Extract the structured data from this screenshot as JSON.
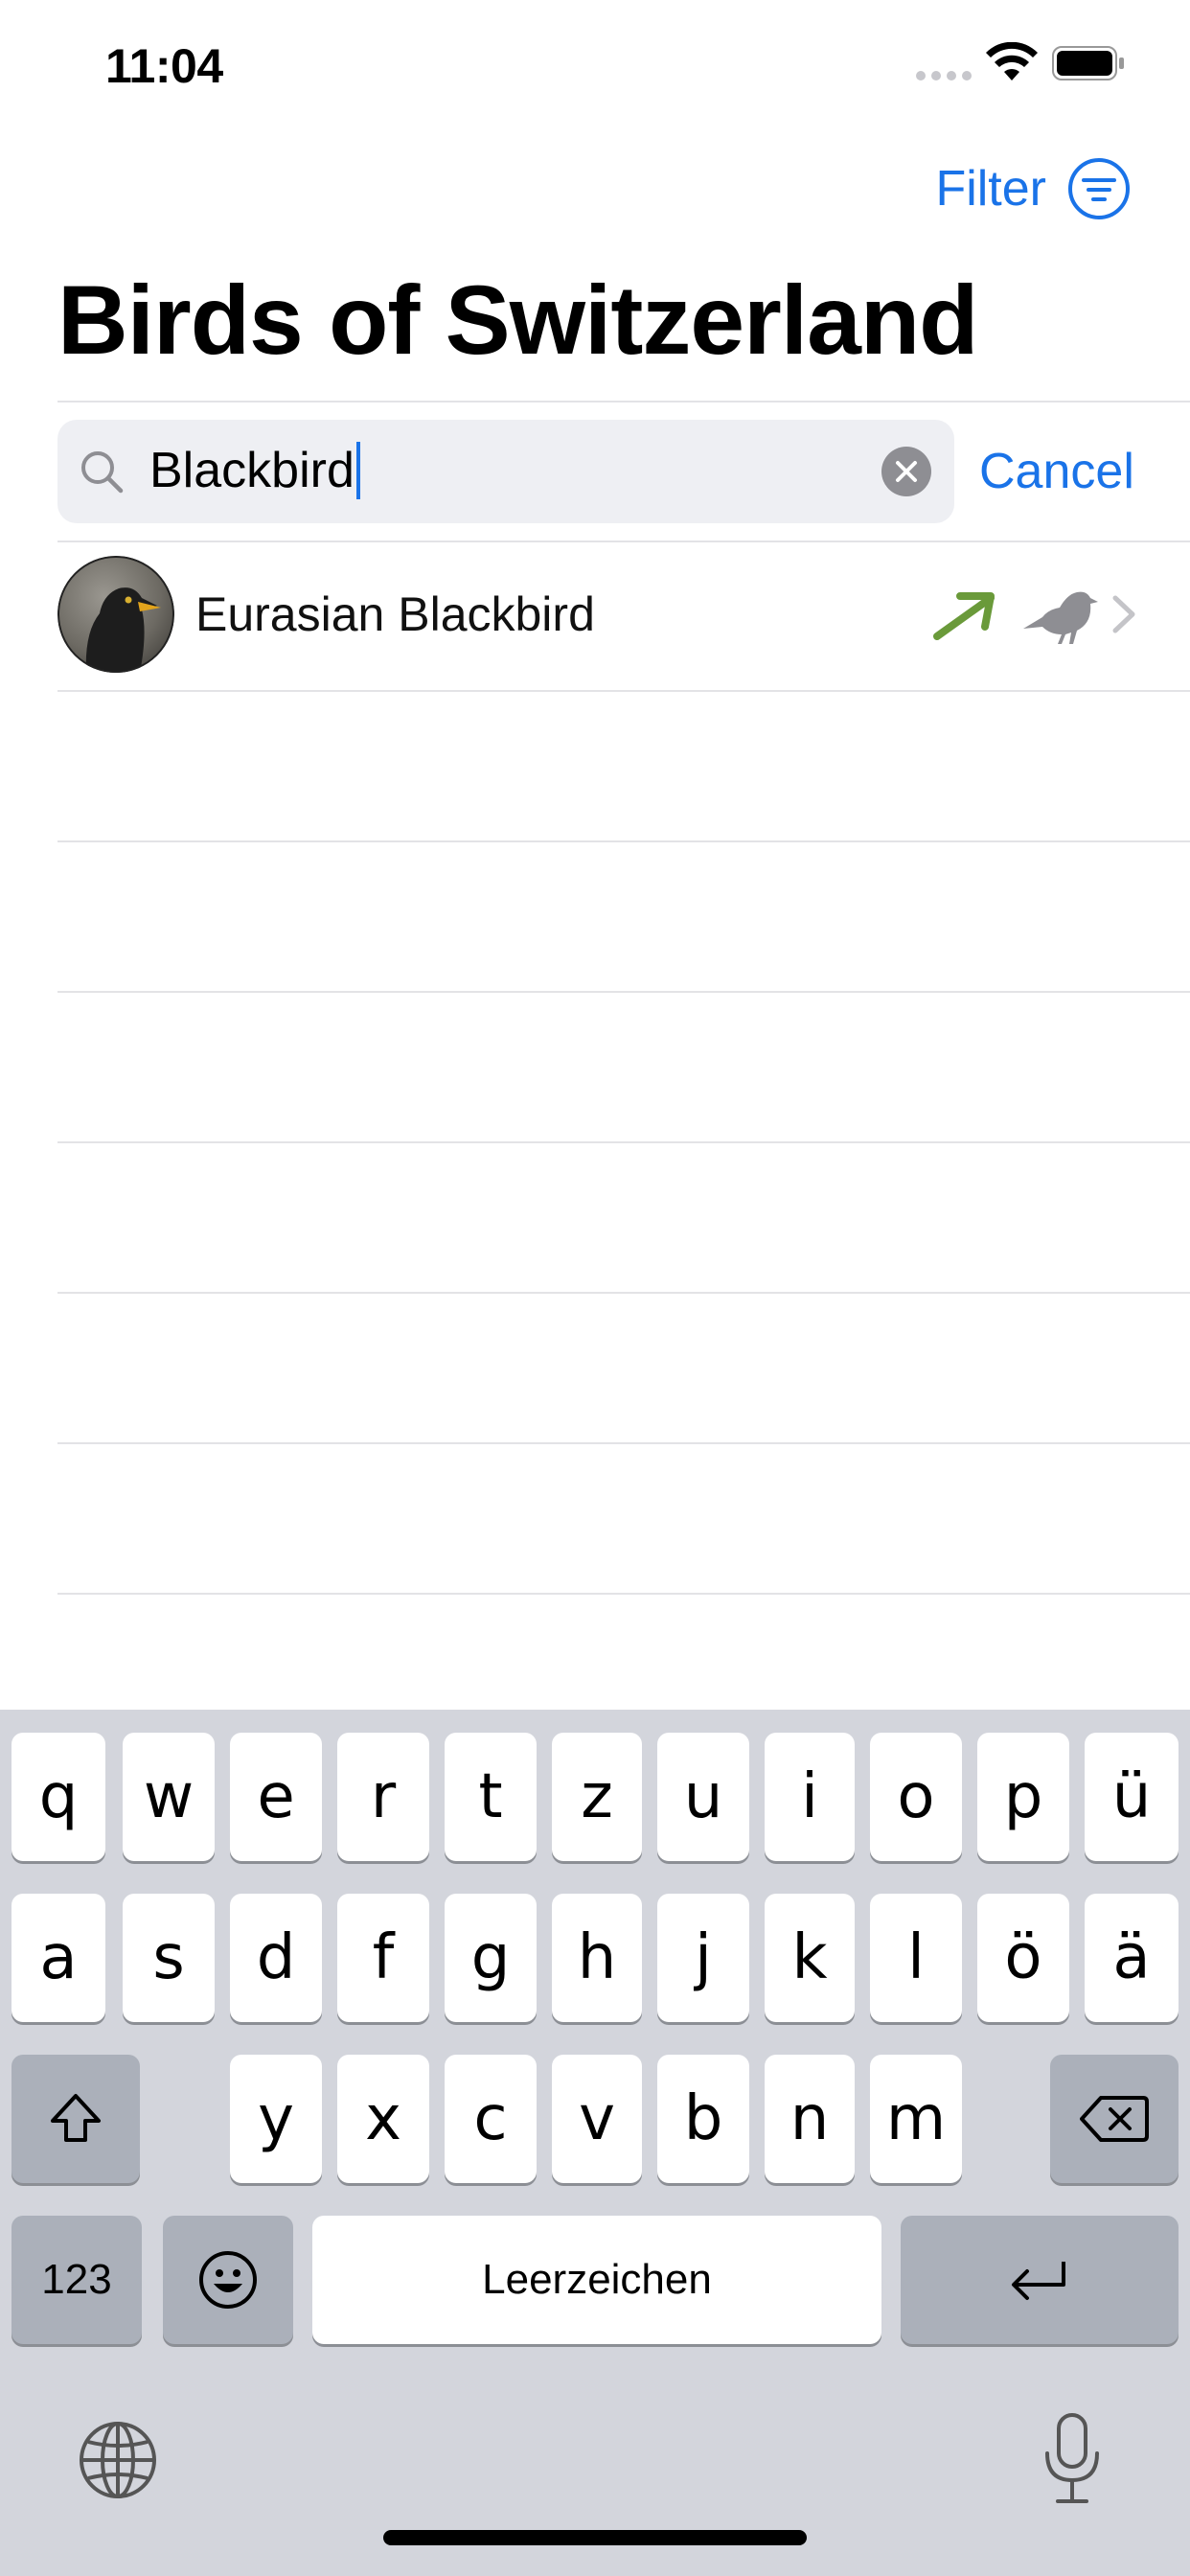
{
  "status_bar": {
    "time": "11:04"
  },
  "nav": {
    "filter_label": "Filter",
    "title": "Birds of Switzerland"
  },
  "search": {
    "value": "Blackbird",
    "cancel_label": "Cancel"
  },
  "results": [
    {
      "name": "Eurasian Blackbird",
      "trend_color": "#6a9a3a"
    }
  ],
  "colors": {
    "accent": "#1a73e8",
    "trend_up": "#6a9a3a",
    "secondary_icon": "#8e8e93"
  },
  "keyboard": {
    "row1": [
      "q",
      "w",
      "e",
      "r",
      "t",
      "z",
      "u",
      "i",
      "o",
      "p",
      "ü"
    ],
    "row2": [
      "a",
      "s",
      "d",
      "f",
      "g",
      "h",
      "j",
      "k",
      "l",
      "ö",
      "ä"
    ],
    "row3": [
      "y",
      "x",
      "c",
      "v",
      "b",
      "n",
      "m"
    ],
    "numbers_key": "123",
    "space_label": "Leerzeichen"
  }
}
